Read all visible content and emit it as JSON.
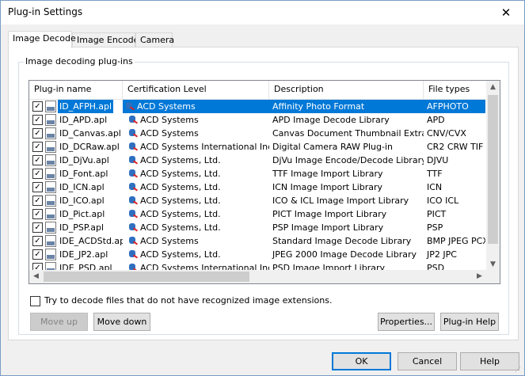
{
  "window": {
    "title": "Plug-in Settings",
    "close_glyph": "✕"
  },
  "tabs": [
    {
      "label": "Image Decode",
      "active": true
    },
    {
      "label": "Image Encode",
      "active": false
    },
    {
      "label": "Camera",
      "active": false
    }
  ],
  "group": {
    "label": "Image decoding plug-ins"
  },
  "columns": [
    "Plug-in name",
    "Certification Level",
    "Description",
    "File types"
  ],
  "rows": [
    {
      "checked": true,
      "name": "ID_AFPH.apl",
      "cert": "ACD Systems",
      "desc": "Affinity Photo Format",
      "types": "AFPHOTO",
      "selected": true
    },
    {
      "checked": true,
      "name": "ID_APD.apl",
      "cert": "ACD Systems",
      "desc": "APD Image Decode Library",
      "types": "APD",
      "selected": false
    },
    {
      "checked": true,
      "name": "ID_Canvas.apl",
      "cert": "ACD Systems",
      "desc": "Canvas Document Thumbnail Extractor",
      "types": "CNV/CVX",
      "selected": false
    },
    {
      "checked": true,
      "name": "ID_DCRaw.apl",
      "cert": "ACD Systems International Inc.",
      "desc": "Digital Camera RAW Plug-in",
      "types": "CR2 CRW TIF",
      "selected": false
    },
    {
      "checked": true,
      "name": "ID_DjVu.apl",
      "cert": "ACD Systems, Ltd.",
      "desc": "DjVu Image Encode/Decode Library",
      "types": "DJVU",
      "selected": false
    },
    {
      "checked": true,
      "name": "ID_Font.apl",
      "cert": "ACD Systems, Ltd.",
      "desc": "TTF Image Import Library",
      "types": "TTF",
      "selected": false
    },
    {
      "checked": true,
      "name": "ID_ICN.apl",
      "cert": "ACD Systems, Ltd.",
      "desc": "ICN Image Import Library",
      "types": "ICN",
      "selected": false
    },
    {
      "checked": true,
      "name": "ID_ICO.apl",
      "cert": "ACD Systems, Ltd.",
      "desc": "ICO & ICL Image Import Library",
      "types": "ICO ICL",
      "selected": false
    },
    {
      "checked": true,
      "name": "ID_Pict.apl",
      "cert": "ACD Systems, Ltd.",
      "desc": "PICT Image Import Library",
      "types": "PICT",
      "selected": false
    },
    {
      "checked": true,
      "name": "ID_PSP.apl",
      "cert": "ACD Systems, Ltd.",
      "desc": "PSP Image Import Library",
      "types": "PSP",
      "selected": false
    },
    {
      "checked": true,
      "name": "IDE_ACDStd.apl",
      "cert": "ACD Systems",
      "desc": "Standard Image Decode Library",
      "types": "BMP JPEG PCX",
      "selected": false
    },
    {
      "checked": true,
      "name": "IDE_JP2.apl",
      "cert": "ACD Systems, Ltd.",
      "desc": "JPEG 2000 Image Decode Library",
      "types": "JP2 JPC",
      "selected": false
    },
    {
      "checked": true,
      "name": "IDE_PSD.apl",
      "cert": "ACD Systems International Inc.",
      "desc": "PSD Image Import Library",
      "types": "PSD",
      "selected": false
    }
  ],
  "decode_unrecognized": {
    "label": "Try to decode files that do not have recognized image extensions.",
    "checked": false
  },
  "buttons": {
    "move_up": "Move up",
    "move_down": "Move down",
    "properties": "Properties...",
    "plugin_help": "Plug-in Help",
    "ok": "OK",
    "cancel": "Cancel",
    "help": "Help"
  },
  "colors": {
    "selection": "#0078d7",
    "accent_border": "#0078d7"
  }
}
